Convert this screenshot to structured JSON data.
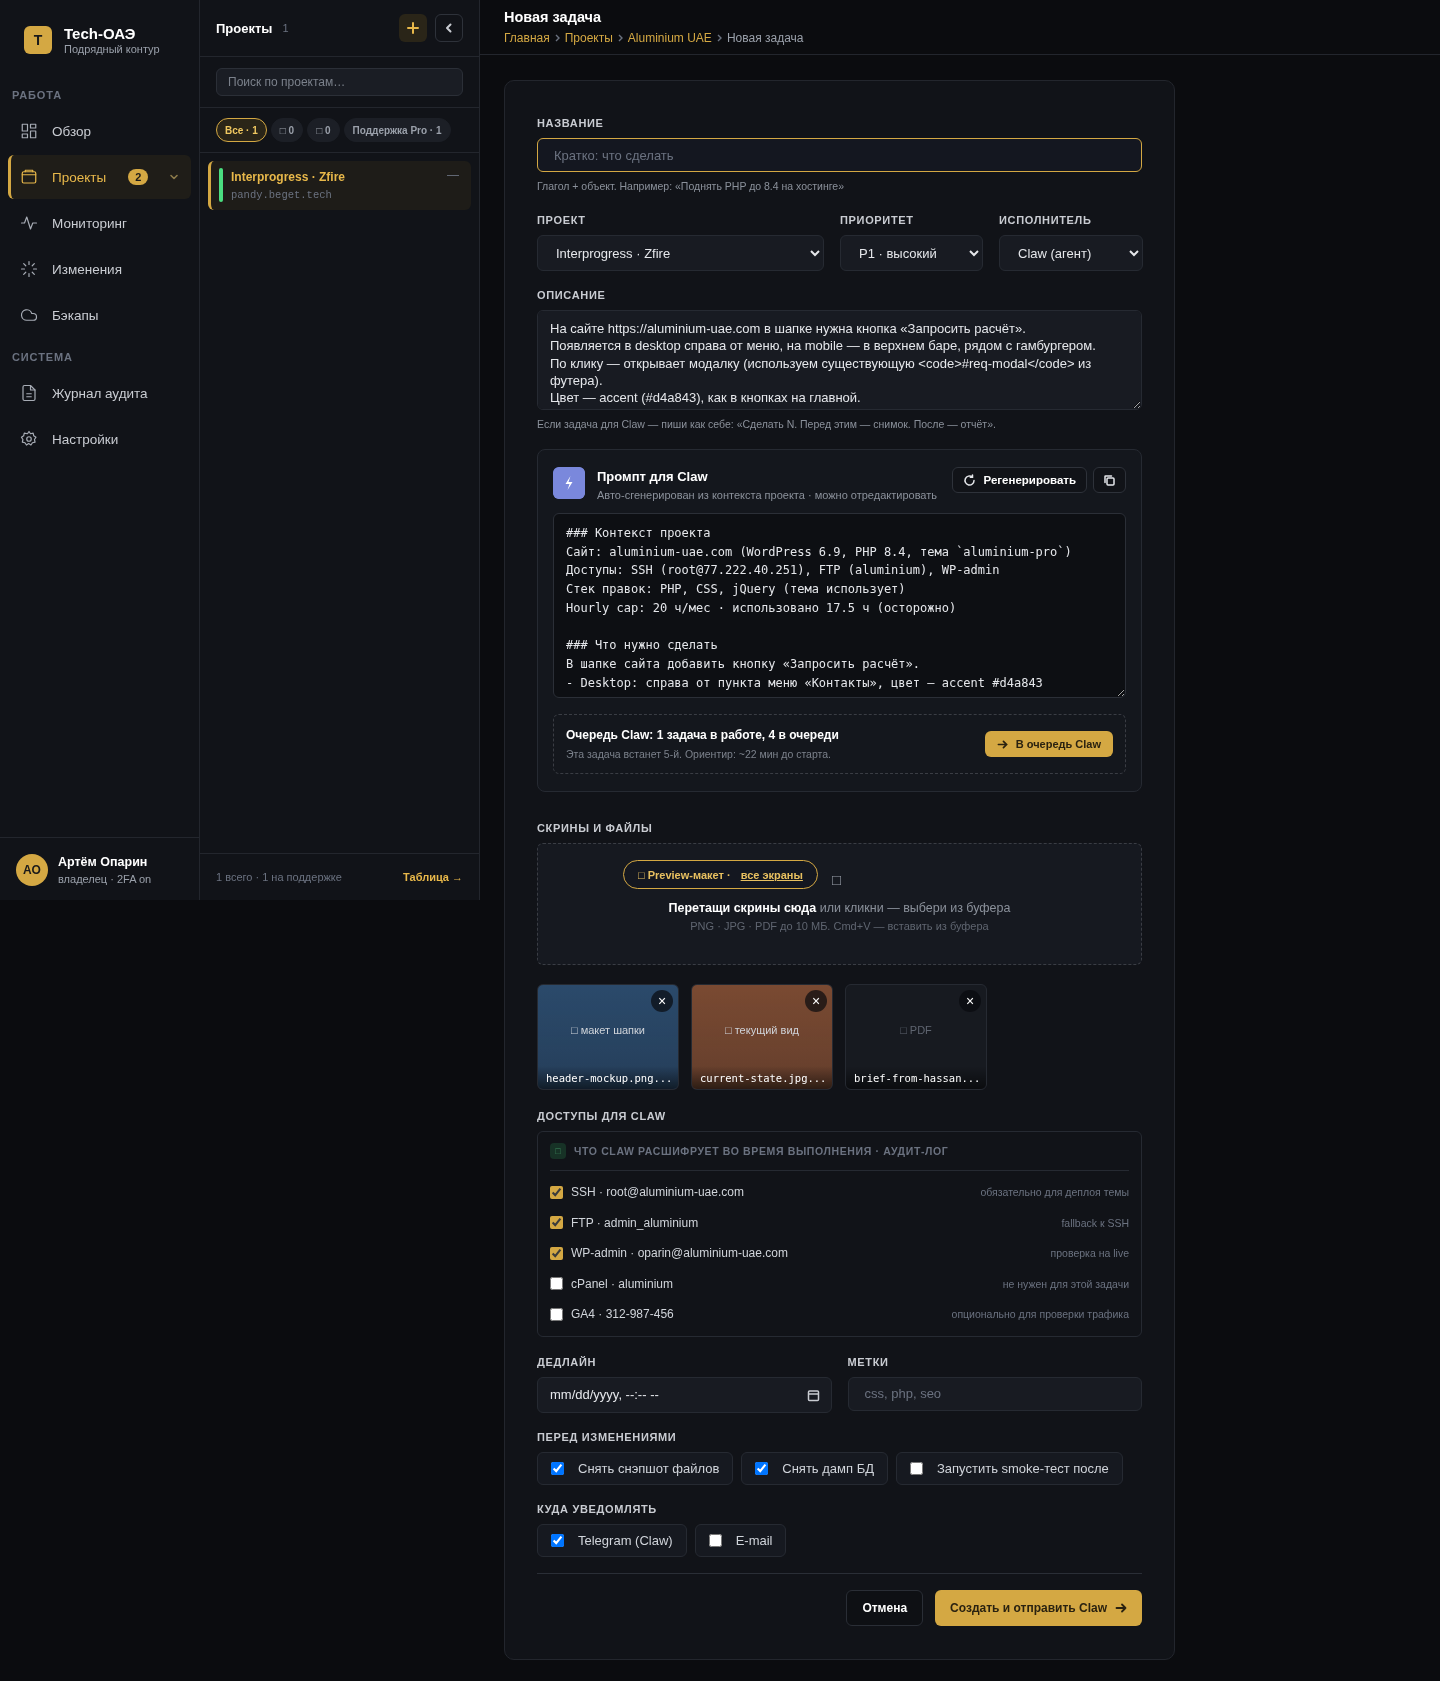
{
  "sidebar": {
    "brand": {
      "logo_letter": "T",
      "name": "Tech-ОАЭ",
      "subtitle": "Подрядный контур"
    },
    "sections": [
      {
        "label": "РАБОТА",
        "items": [
          {
            "label": "Обзор",
            "selected": false
          },
          {
            "label": "Проекты",
            "selected": true,
            "badge": "2",
            "expandable": true
          },
          {
            "label": "Мониторинг",
            "selected": false
          },
          {
            "label": "Изменения",
            "selected": false
          },
          {
            "label": "Бэкапы",
            "selected": false
          }
        ]
      },
      {
        "label": "СИСТЕМА",
        "items": [
          {
            "label": "Журнал аудита",
            "selected": false
          },
          {
            "label": "Настройки",
            "selected": false
          }
        ]
      }
    ],
    "user": {
      "initials": "АО",
      "name": "Артём Опарин",
      "role": "владелец · 2FA on"
    }
  },
  "projects_panel": {
    "title": "Проекты",
    "count": "1",
    "search": {
      "placeholder": "Поиск по проектам…"
    },
    "filters": [
      {
        "label": "Все · 1",
        "selected": true
      },
      {
        "label": "□ 0",
        "selected": false
      },
      {
        "label": "□ 0",
        "selected": false
      },
      {
        "label": "Поддержка Pro · 1",
        "selected": false
      }
    ],
    "projects": [
      {
        "name": "Interprogress · Zfire",
        "host": "pandy.beget.tech",
        "trailing": "—",
        "selected": true,
        "color": "#4ade80"
      }
    ],
    "footer": {
      "summary": "1 всего · 1 на поддержке",
      "link": "Таблица →"
    }
  },
  "page": {
    "title": "Новая задача",
    "breadcrumbs": [
      {
        "label": "Главная",
        "link": true
      },
      {
        "label": "Проекты",
        "link": true
      },
      {
        "label": "Aluminium UAE",
        "link": true
      },
      {
        "label": "Новая задача",
        "link": false
      }
    ]
  },
  "form": {
    "title_field": {
      "label": "НАЗВАНИЕ",
      "placeholder": "Кратко: что сделать",
      "hint": "Глагол + объект. Например: «Поднять PHP до 8.4 на хостинге»"
    },
    "selects": [
      {
        "label": "ПРОЕКТ",
        "value": "Interprogress · Zfire"
      },
      {
        "label": "ПРИОРИТЕТ",
        "value": "P1 · высокий"
      },
      {
        "label": "ИСПОЛНИТЕЛЬ",
        "value": "Claw (агент)"
      }
    ],
    "description": {
      "label": "ОПИСАНИЕ",
      "value": "На сайте https://aluminium-uae.com в шапке нужна кнопка «Запросить расчёт».\nПоявляется в desktop справа от меню, на mobile — в верхнем баре, рядом с гамбургером.\nПо клику — открывает модалку (используем существующую <code>#req-modal</code> из футера).\nЦвет — accent (#d4a843), как в кнопках на главной.",
      "hint": "Если задача для Claw — пиши как себе: «Сделать N. Перед этим — снимок. После — отчёт»."
    },
    "prompt": {
      "title": "Промпт для Claw",
      "subtitle": "Авто-сгенерирован из контекста проекта · можно отредактировать",
      "regenerate": "Регенерировать",
      "text": "### Контекст проекта\nСайт: aluminium-uae.com (WordPress 6.9, PHP 8.4, тема `aluminium-pro`)\nДоступы: SSH (root@77.222.40.251), FTP (aluminium), WP-admin\nСтек правок: PHP, CSS, jQuery (тема использует)\nHourly cap: 20 ч/мес · использовано 17.5 ч (осторожно)\n\n### Что нужно сделать\nВ шапке сайта добавить кнопку «Запросить расчёт».\n- Desktop: справа от пункта меню «Контакты», цвет — accent #d4a843",
      "queue": {
        "title": "Очередь Claw: 1 задача в работе, 4 в очереди",
        "note": "Эта задача встанет 5-й. Ориентир: ~22 мин до старта.",
        "button": "В очередь Claw"
      }
    },
    "files": {
      "label": "СКРИНЫ И ФАЙЛЫ",
      "preview_chip": {
        "text": "□ Preview-макет ·",
        "link": "все экраны"
      },
      "marker": "□",
      "drop_text": "**Перетащи скрины сюда** или кликни — выбери из буфера",
      "drop_note": "PNG · JPG · PDF до 10 МБ. Cmd+V — вставить из буфера",
      "attachments": [
        {
          "kind": "image",
          "color": "#2b4a6b",
          "caption": "□ макет шапки",
          "filename": "header-mockup.png...",
          "remove": "×"
        },
        {
          "kind": "image",
          "color": "#7a4a32",
          "caption": "□ текущий вид",
          "filename": "current-state.jpg...",
          "remove": "×"
        },
        {
          "kind": "document",
          "caption": "□ PDF",
          "filename": "brief-from-hassan...",
          "remove": "×"
        }
      ]
    },
    "access": {
      "label": "ДОСТУПЫ ДЛЯ CLAW",
      "header_icon": "□",
      "header": "ЧТО CLAW РАСШИФРУЕТ ВО ВРЕМЯ ВЫПОЛНЕНИЯ · АУДИТ-ЛОГ",
      "items": [
        {
          "label": "SSH · root@aluminium-uae.com",
          "note": "обязательно для деплоя темы",
          "checked": true
        },
        {
          "label": "FTP · admin_aluminium",
          "note": "fallback к SSH",
          "checked": true
        },
        {
          "label": "WP-admin · oparin@aluminium-uae.com",
          "note": "проверка на live",
          "checked": true
        },
        {
          "label": "cPanel · aluminium",
          "note": "не нужен для этой задачи",
          "checked": false
        },
        {
          "label": "GA4 · 312-987-456",
          "note": "опционально для проверки трафика",
          "checked": false
        }
      ]
    },
    "deadline": {
      "label": "ДЕДЛАЙН",
      "value": "mm/dd/yyyy, --:-- --"
    },
    "tags": {
      "label": "МЕТКИ",
      "placeholder": "css, php, seo"
    },
    "before_changes": {
      "label": "ПЕРЕД ИЗМЕНЕНИЯМИ",
      "options": [
        {
          "label": "Снять снэпшот файлов",
          "checked": true
        },
        {
          "label": "Снять дамп БД",
          "checked": true
        },
        {
          "label": "Запустить smoke-тест после",
          "checked": false
        }
      ]
    },
    "notify": {
      "label": "КУДА УВЕДОМЛЯТЬ",
      "options": [
        {
          "label": "Telegram (Claw)",
          "checked": true
        },
        {
          "label": "E-mail",
          "checked": false
        }
      ]
    },
    "actions": {
      "cancel": "Отмена",
      "submit": "Создать и отправить Claw"
    }
  }
}
